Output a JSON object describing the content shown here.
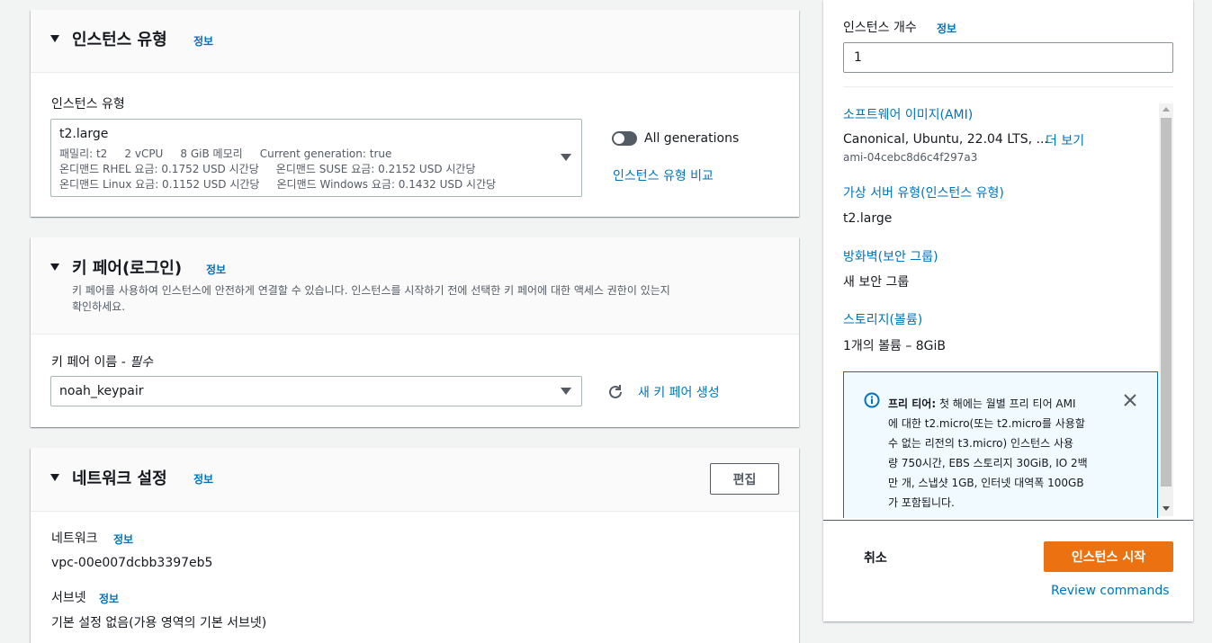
{
  "instance_type_section": {
    "title": "인스턴스 유형",
    "info": "정보",
    "field_label": "인스턴스 유형",
    "selected": {
      "name": "t2.large",
      "line1": "패밀리: t2     2 vCPU     8 GiB 메모리     Current generation: true",
      "line2": "온디맨드 RHEL 요금: 0.1752 USD 시간당     온디맨드 SUSE 요금: 0.2152 USD 시간당",
      "line3": "온디맨드 Linux 요금: 0.1152 USD 시간당     온디맨드 Windows 요금: 0.1432 USD 시간당"
    },
    "toggle_label": "All generations",
    "compare_link": "인스턴스 유형 비교"
  },
  "key_pair_section": {
    "title": "키 페어(로그인)",
    "info": "정보",
    "description_line1": "키 페어를 사용하여 인스턴스에 안전하게 연결할 수 있습니다. 인스턴스를 시작하기 전에 선택한 키 페어에 대한 액세스 권한이 있는지",
    "description_line2": "확인하세요.",
    "field_label": "키 페어 이름 - ",
    "field_required": "필수",
    "selected": "noah_keypair",
    "create_link": "새 키 페어 생성"
  },
  "network_section": {
    "title": "네트워크 설정",
    "info": "정보",
    "edit_button": "편집",
    "network_label": "네트워크",
    "network_info": "정보",
    "network_value": "vpc-00e007dcbb3397eb5",
    "subnet_label": "서브넷",
    "subnet_info": "정보",
    "subnet_value": "기본 설정 없음(가용 영역의 기본 서브넷)"
  },
  "summary": {
    "count_label": "인스턴스 개수",
    "count_info": "정보",
    "count_value": "1",
    "ami_link": "소프트웨어 이미지(AMI)",
    "ami_value": "Canonical, Ubuntu, 22.04 LTS, ...",
    "ami_more": "더 보기",
    "ami_id": "ami-04cebc8d6c4f297a3",
    "server_type_link": "가상 서버 유형(인스턴스 유형)",
    "server_type_value": "t2.large",
    "firewall_link": "방화벽(보안 그룹)",
    "firewall_value": "새 보안 그룹",
    "storage_link": "스토리지(볼륨)",
    "storage_value": "1개의 볼륨 – 8GiB",
    "free_tier": {
      "title": "프리 티어:",
      "line1": " 첫 해에는 월별 프리 티어 AMI",
      "line2": "에 대한 t2.micro(또는 t2.micro를 사용할",
      "line3": "수 없는 리전의 t3.micro) 인스턴스 사용",
      "line4": "량 750시간, EBS 스토리지 30GiB, IO 2백",
      "line5": "만 개, 스냅샷 1GB, 인터넷 대역폭 100GB",
      "line6": "가 포함됩니다."
    },
    "cancel_button": "취소",
    "launch_button": "인스턴스 시작",
    "review_link": "Review commands"
  },
  "colors": {
    "link": "#0073bb",
    "primary": "#ec7211",
    "info_border": "#0073bb",
    "info_bg": "#f1faff"
  },
  "icons": [
    "caret-down-icon",
    "dropdown-arrow-icon",
    "refresh-icon",
    "info-circle-icon",
    "close-icon",
    "toggle-switch"
  ]
}
